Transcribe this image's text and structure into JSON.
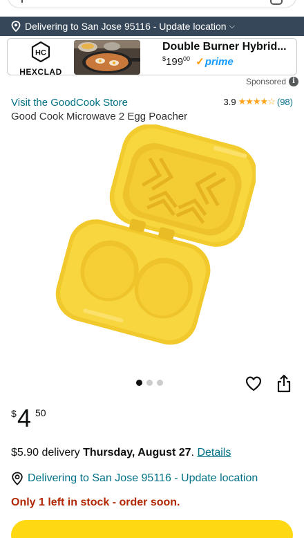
{
  "location_bar": {
    "text": "Delivering to San Jose 95116 - Update location"
  },
  "ad": {
    "brand": "HEXCLAD",
    "brand_mark": "HC",
    "title": "Double Burner Hybrid...",
    "price_currency": "$",
    "price_whole": "199",
    "price_fraction": "00",
    "prime_label": "prime",
    "sponsored_label": "Sponsored",
    "info_glyph": "i"
  },
  "product": {
    "store_link": "Visit the GoodCook Store",
    "rating_value": "3.9",
    "rating_stars": 3.9,
    "rating_count": "(98)",
    "title": "Good Cook Microwave 2 Egg Poacher",
    "image_count": 3,
    "active_image": 0
  },
  "price": {
    "currency": "$",
    "whole": "4",
    "fraction": "50"
  },
  "delivery": {
    "fee": "$5.90 delivery",
    "date": "Thursday, August 27",
    "period": ".",
    "details_link": "Details",
    "deliver_to": "Delivering to San Jose 95116 - Update location",
    "stock_message": "Only 1 left in stock - order soon."
  },
  "colors": {
    "location_bar_bg": "#37475A",
    "link": "#007185",
    "stock_red": "#B12704",
    "star": "#FFA41C",
    "prime_blue": "#1399FF",
    "cta_yellow": "#FFD814",
    "product_yellow": "#F7D33A"
  },
  "icons": {
    "location": "location-pin-icon",
    "wishlist": "heart-icon",
    "share": "share-icon"
  }
}
